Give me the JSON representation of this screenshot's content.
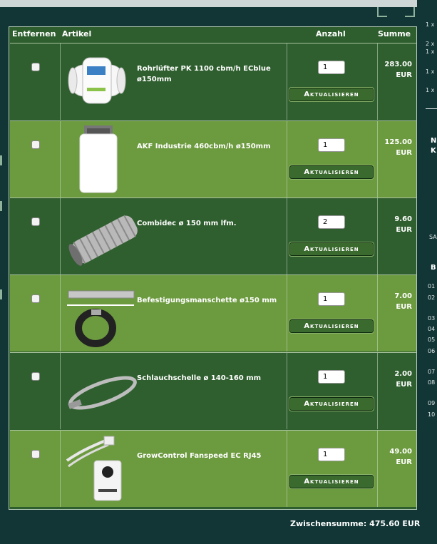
{
  "header": {
    "remove": "Entfernen",
    "article": "Artikel",
    "quantity": "Anzahl",
    "sum": "Summe"
  },
  "button_label": "Aktualisieren",
  "items": [
    {
      "name": "Rohrlüfter PK 1100 cbm/h ECblue ø150mm",
      "quantity": "1",
      "price": "283.00",
      "currency": "EUR"
    },
    {
      "name": "AKF Industrie 460cbm/h ø150mm",
      "quantity": "1",
      "price": "125.00",
      "currency": "EUR"
    },
    {
      "name": "Combidec ø 150 mm lfm.",
      "quantity": "2",
      "price": "9.60",
      "currency": "EUR"
    },
    {
      "name": "Befestigungsmanschette ø150 mm",
      "quantity": "1",
      "price": "7.00",
      "currency": "EUR"
    },
    {
      "name": "Schlauchschelle ø 140-160 mm",
      "quantity": "1",
      "price": "2.00",
      "currency": "EUR"
    },
    {
      "name": "GrowControl Fanspeed EC RJ45",
      "quantity": "1",
      "price": "49.00",
      "currency": "EUR"
    }
  ],
  "subtotal": "Zwischensumme: 475.60 EUR",
  "right_panel": {
    "counts": [
      "1 x",
      "2 x",
      "1 x",
      "1 x",
      "1 x"
    ],
    "letters_n": "N",
    "letters_k": "K",
    "sa": "SA",
    "b": "B",
    "numbers": [
      "01",
      "02",
      "03",
      "04",
      "05",
      "06",
      "07",
      "08",
      "09",
      "10"
    ]
  },
  "colors": {
    "light_row": "#6c9a3e",
    "dark_row": "#2f5f2f",
    "background": "#123636"
  }
}
